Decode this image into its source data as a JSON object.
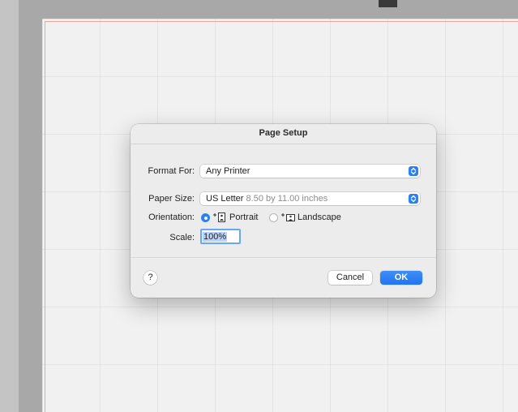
{
  "dialog": {
    "title": "Page Setup",
    "format_for": {
      "label": "Format For:",
      "value": "Any Printer"
    },
    "paper_size": {
      "label": "Paper Size:",
      "value": "US Letter",
      "detail": "8.50 by 11.00 inches"
    },
    "orientation": {
      "label": "Orientation:",
      "options": [
        {
          "label": "Portrait",
          "selected": true,
          "icon": "portrait-orientation-icon"
        },
        {
          "label": "Landscape",
          "selected": false,
          "icon": "landscape-orientation-icon"
        }
      ]
    },
    "scale": {
      "label": "Scale:",
      "value": "100%"
    },
    "help_label": "?",
    "cancel_label": "Cancel",
    "ok_label": "OK"
  },
  "colors": {
    "accent": "#2a7ff5",
    "dialog_background": "#ececec",
    "page_margin_guide": "#e9a7a0"
  }
}
